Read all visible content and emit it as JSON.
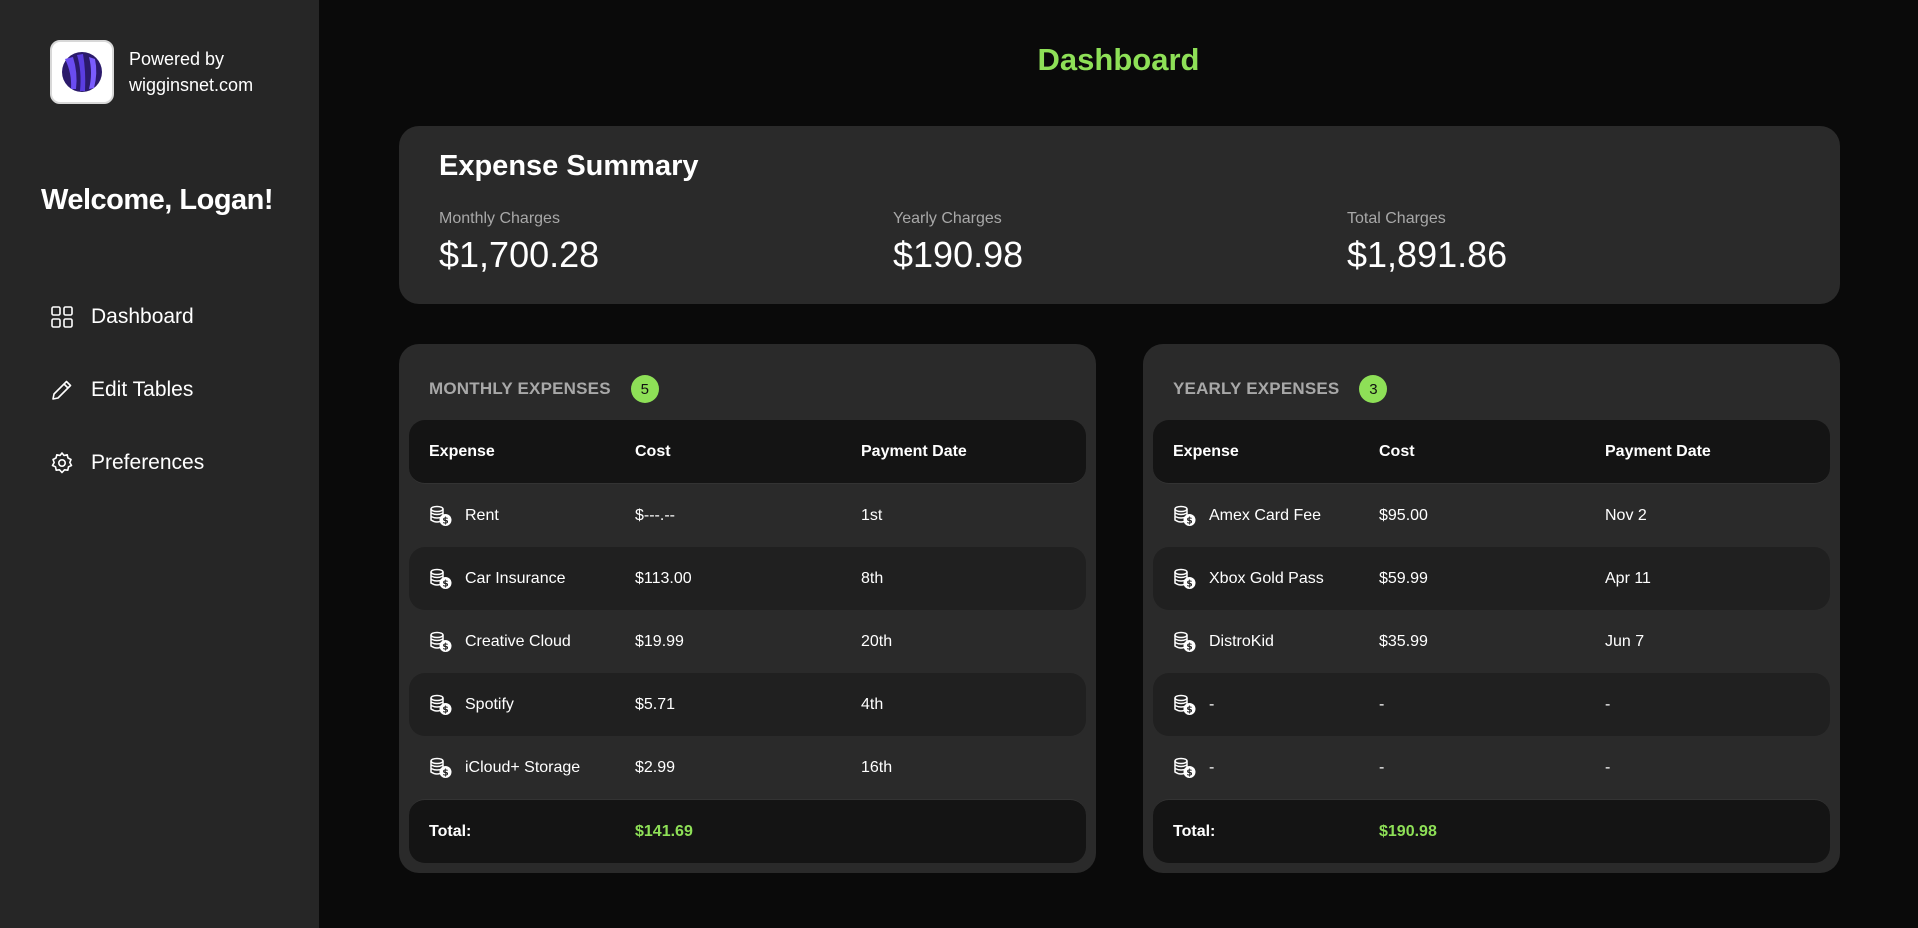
{
  "sidebar": {
    "brand": {
      "line1": "Powered by",
      "line2": "wigginsnet.com"
    },
    "welcome": "Welcome, Logan!",
    "nav": [
      {
        "label": "Dashboard",
        "icon": "grid-icon"
      },
      {
        "label": "Edit Tables",
        "icon": "pencil-icon"
      },
      {
        "label": "Preferences",
        "icon": "gear-icon"
      }
    ]
  },
  "main": {
    "title": "Dashboard",
    "summary": {
      "title": "Expense Summary",
      "stats": [
        {
          "label": "Monthly Charges",
          "value": "$1,700.28"
        },
        {
          "label": "Yearly Charges",
          "value": "$190.98"
        },
        {
          "label": "Total Charges",
          "value": "$1,891.86"
        }
      ]
    },
    "monthly": {
      "title": "MONTHLY EXPENSES",
      "count": "5",
      "columns": [
        "Expense",
        "Cost",
        "Payment Date"
      ],
      "rows": [
        {
          "expense": "Rent",
          "cost": "$---.--",
          "date": "1st"
        },
        {
          "expense": "Car Insurance",
          "cost": "$113.00",
          "date": "8th"
        },
        {
          "expense": "Creative Cloud",
          "cost": "$19.99",
          "date": "20th"
        },
        {
          "expense": "Spotify",
          "cost": "$5.71",
          "date": "4th"
        },
        {
          "expense": "iCloud+ Storage",
          "cost": "$2.99",
          "date": "16th"
        }
      ],
      "total_label": "Total:",
      "total_value": "$141.69"
    },
    "yearly": {
      "title": "YEARLY EXPENSES",
      "count": "3",
      "columns": [
        "Expense",
        "Cost",
        "Payment Date"
      ],
      "rows": [
        {
          "expense": "Amex Card Fee",
          "cost": "$95.00",
          "date": "Nov 2"
        },
        {
          "expense": "Xbox Gold Pass",
          "cost": "$59.99",
          "date": "Apr 11"
        },
        {
          "expense": "DistroKid",
          "cost": "$35.99",
          "date": "Jun 7"
        },
        {
          "expense": "-",
          "cost": "-",
          "date": "-"
        },
        {
          "expense": "-",
          "cost": "-",
          "date": "-"
        }
      ],
      "total_label": "Total:",
      "total_value": "$190.98"
    }
  },
  "colors": {
    "accent": "#8ee057",
    "sidebar": "#262626",
    "card": "#2a2a2a",
    "background": "#0a0a0a"
  }
}
